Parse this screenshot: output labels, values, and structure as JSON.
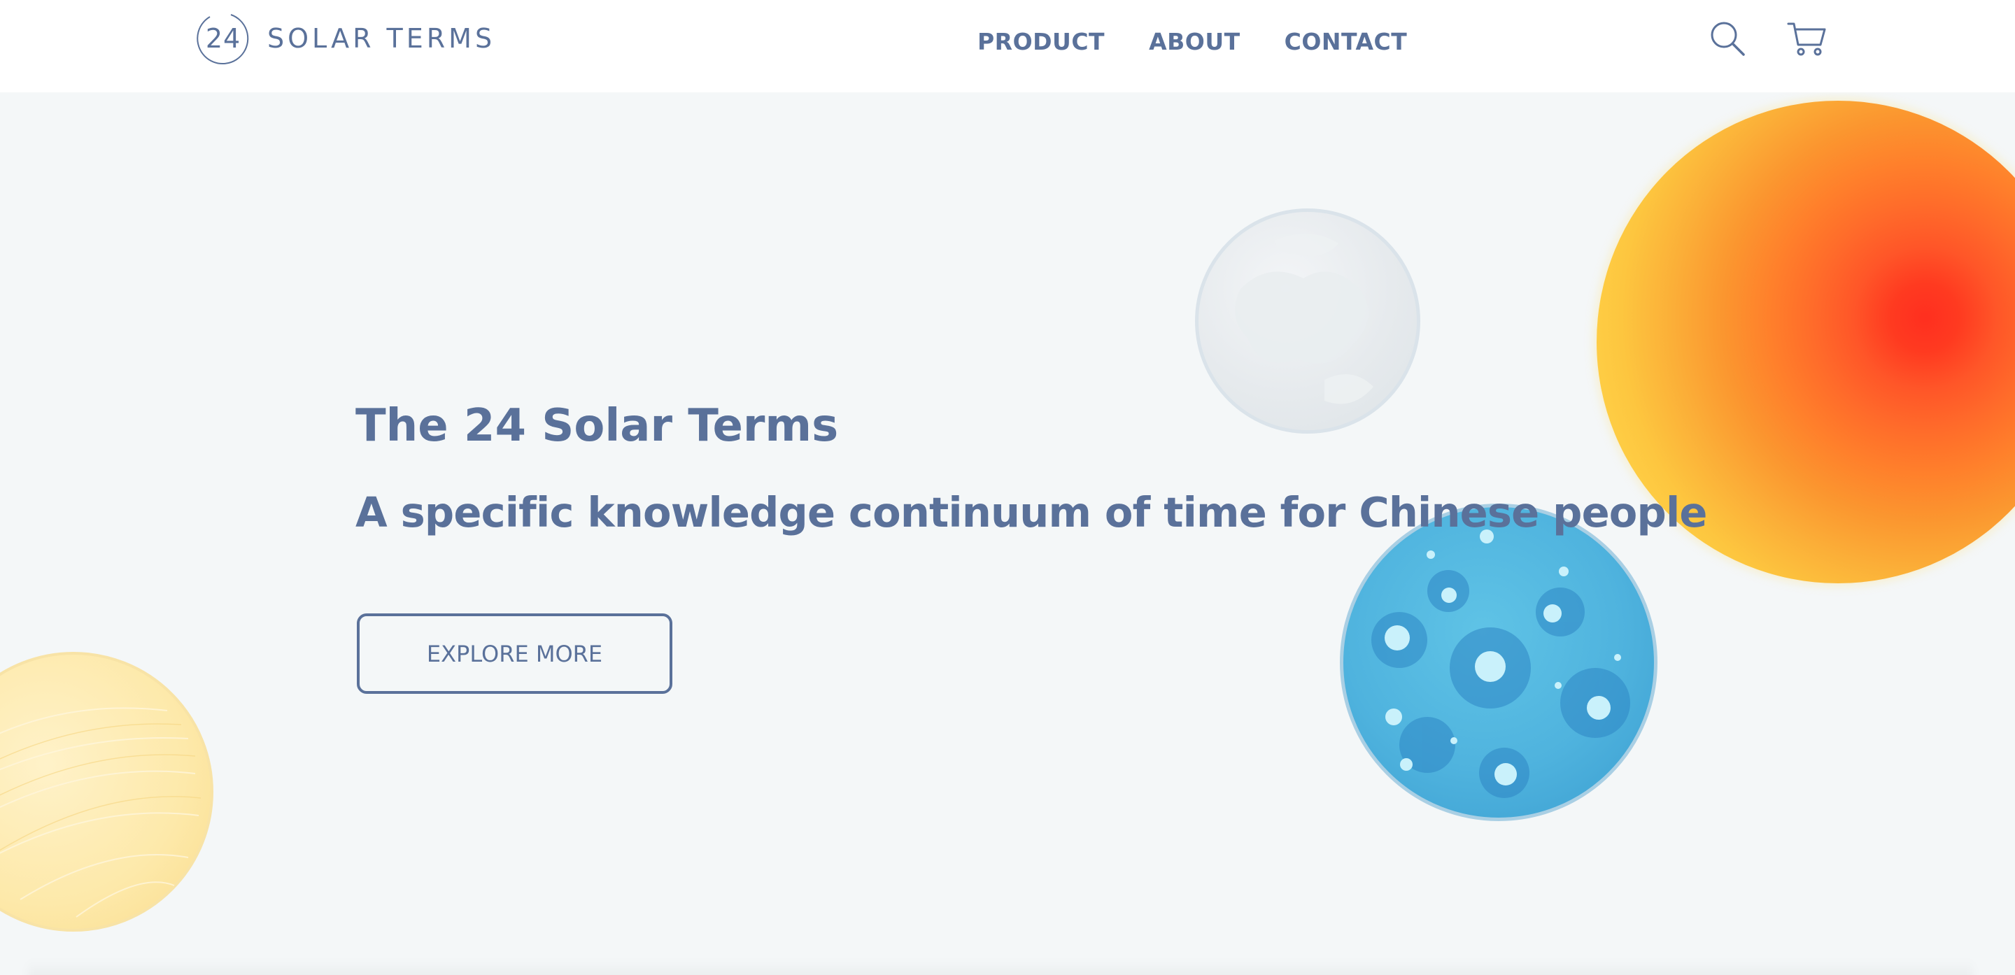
{
  "header": {
    "logo_number": "24",
    "logo_text": "SOLAR TERMS",
    "nav": [
      "PRODUCT",
      "ABOUT",
      "CONTACT"
    ],
    "icons": [
      "search-icon",
      "cart-icon"
    ]
  },
  "hero": {
    "title": "The 24 Solar Terms",
    "subtitle": "A specific knowledge continuum of time for Chinese people",
    "cta_label": "EXPLORE MORE"
  },
  "colors": {
    "text": "#5a719a",
    "background": "#f4f7f8",
    "header_bg": "#ffffff",
    "sun_outer": "#ffd34d",
    "sun_core": "#ff3b1f",
    "moon": "#e8ecef",
    "water_planet": "#4fb3de",
    "sand_planet": "#fde7a6"
  }
}
